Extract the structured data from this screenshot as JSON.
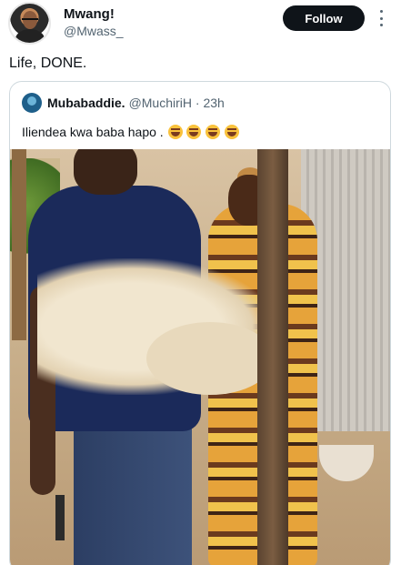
{
  "author": {
    "display_name": "Mwang!",
    "handle": "@Mwass_"
  },
  "actions": {
    "follow_label": "Follow"
  },
  "tweet": {
    "text": "Life, DONE."
  },
  "quoted": {
    "display_name": "Mubabaddie.",
    "handle": "@MuchiriH",
    "time": "23h",
    "text": "Iliendea kwa baba hapo ."
  },
  "icons": [
    "avatar",
    "more-icon",
    "quoted-avatar",
    "laughing-emoji"
  ]
}
